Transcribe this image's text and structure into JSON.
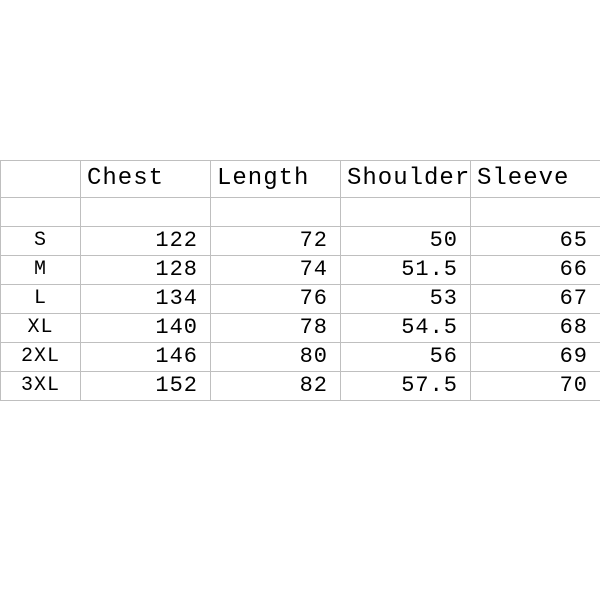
{
  "chart_data": {
    "type": "table",
    "columns": [
      "",
      "Chest",
      "Length",
      "Shoulder",
      "Sleeve"
    ],
    "rows": [
      {
        "size": "S",
        "chest": 122,
        "length": 72,
        "shoulder": 50,
        "sleeve": 65
      },
      {
        "size": "M",
        "chest": 128,
        "length": 74,
        "shoulder": 51.5,
        "sleeve": 66
      },
      {
        "size": "L",
        "chest": 134,
        "length": 76,
        "shoulder": 53,
        "sleeve": 67
      },
      {
        "size": "XL",
        "chest": 140,
        "length": 78,
        "shoulder": 54.5,
        "sleeve": 68
      },
      {
        "size": "2XL",
        "chest": 146,
        "length": 80,
        "shoulder": 56,
        "sleeve": 69
      },
      {
        "size": "3XL",
        "chest": 152,
        "length": 82,
        "shoulder": 57.5,
        "sleeve": 70
      }
    ]
  },
  "headers": {
    "size": "",
    "chest": "Chest",
    "length": "Length",
    "shoulder": "Shoulder",
    "sleeve": "Sleeve"
  },
  "rows": [
    {
      "size": "S",
      "chest": "122",
      "length": "72",
      "shoulder": "50",
      "sleeve": "65"
    },
    {
      "size": "M",
      "chest": "128",
      "length": "74",
      "shoulder": "51.5",
      "sleeve": "66"
    },
    {
      "size": "L",
      "chest": "134",
      "length": "76",
      "shoulder": "53",
      "sleeve": "67"
    },
    {
      "size": "XL",
      "chest": "140",
      "length": "78",
      "shoulder": "54.5",
      "sleeve": "68"
    },
    {
      "size": "2XL",
      "chest": "146",
      "length": "80",
      "shoulder": "56",
      "sleeve": "69"
    },
    {
      "size": "3XL",
      "chest": "152",
      "length": "82",
      "shoulder": "57.5",
      "sleeve": "70"
    }
  ]
}
